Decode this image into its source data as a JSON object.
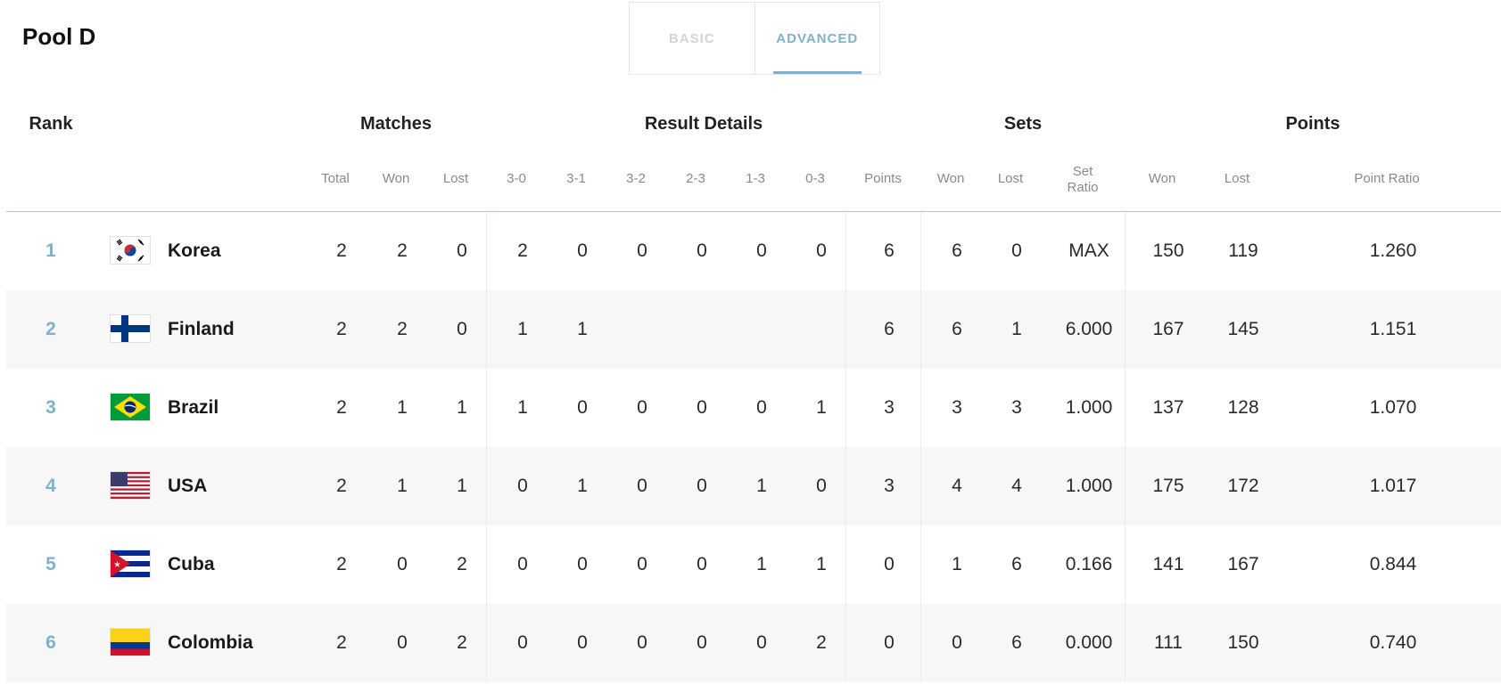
{
  "pool_title": "Pool D",
  "tabs": [
    {
      "label": "BASIC",
      "active": false
    },
    {
      "label": "ADVANCED",
      "active": true
    }
  ],
  "accent_color": "#7eb2cc",
  "group_headers": {
    "rank": "Rank",
    "matches": "Matches",
    "result_details": "Result Details",
    "sets": "Sets",
    "points": "Points"
  },
  "columns": {
    "total": "Total",
    "won": "Won",
    "lost": "Lost",
    "r30": "3-0",
    "r31": "3-1",
    "r32": "3-2",
    "r23": "2-3",
    "r13": "1-3",
    "r03": "0-3",
    "points": "Points",
    "sets_won": "Won",
    "sets_lost": "Lost",
    "set_ratio_1": "Set",
    "set_ratio_2": "Ratio",
    "pts_won": "Won",
    "pts_lost": "Lost",
    "point_ratio": "Point Ratio"
  },
  "teams": [
    {
      "rank": "1",
      "name": "Korea",
      "flag": "korea-flag-icon",
      "total": "2",
      "won": "2",
      "lost": "0",
      "r30": "2",
      "r31": "0",
      "r32": "0",
      "r23": "0",
      "r13": "0",
      "r03": "0",
      "points": "6",
      "sets_won": "6",
      "sets_lost": "0",
      "set_ratio": "MAX",
      "pts_won": "150",
      "pts_lost": "119",
      "point_ratio": "1.260"
    },
    {
      "rank": "2",
      "name": "Finland",
      "flag": "finland-flag-icon",
      "total": "2",
      "won": "2",
      "lost": "0",
      "r30": "1",
      "r31": "1",
      "r32": "",
      "r23": "",
      "r13": "",
      "r03": "",
      "points": "6",
      "sets_won": "6",
      "sets_lost": "1",
      "set_ratio": "6.000",
      "pts_won": "167",
      "pts_lost": "145",
      "point_ratio": "1.151"
    },
    {
      "rank": "3",
      "name": "Brazil",
      "flag": "brazil-flag-icon",
      "total": "2",
      "won": "1",
      "lost": "1",
      "r30": "1",
      "r31": "0",
      "r32": "0",
      "r23": "0",
      "r13": "0",
      "r03": "1",
      "points": "3",
      "sets_won": "3",
      "sets_lost": "3",
      "set_ratio": "1.000",
      "pts_won": "137",
      "pts_lost": "128",
      "point_ratio": "1.070"
    },
    {
      "rank": "4",
      "name": "USA",
      "flag": "usa-flag-icon",
      "total": "2",
      "won": "1",
      "lost": "1",
      "r30": "0",
      "r31": "1",
      "r32": "0",
      "r23": "0",
      "r13": "1",
      "r03": "0",
      "points": "3",
      "sets_won": "4",
      "sets_lost": "4",
      "set_ratio": "1.000",
      "pts_won": "175",
      "pts_lost": "172",
      "point_ratio": "1.017"
    },
    {
      "rank": "5",
      "name": "Cuba",
      "flag": "cuba-flag-icon",
      "total": "2",
      "won": "0",
      "lost": "2",
      "r30": "0",
      "r31": "0",
      "r32": "0",
      "r23": "0",
      "r13": "1",
      "r03": "1",
      "points": "0",
      "sets_won": "1",
      "sets_lost": "6",
      "set_ratio": "0.166",
      "pts_won": "141",
      "pts_lost": "167",
      "point_ratio": "0.844"
    },
    {
      "rank": "6",
      "name": "Colombia",
      "flag": "colombia-flag-icon",
      "total": "2",
      "won": "0",
      "lost": "2",
      "r30": "0",
      "r31": "0",
      "r32": "0",
      "r23": "0",
      "r13": "0",
      "r03": "2",
      "points": "0",
      "sets_won": "0",
      "sets_lost": "6",
      "set_ratio": "0.000",
      "pts_won": "111",
      "pts_lost": "150",
      "point_ratio": "0.740"
    }
  ]
}
